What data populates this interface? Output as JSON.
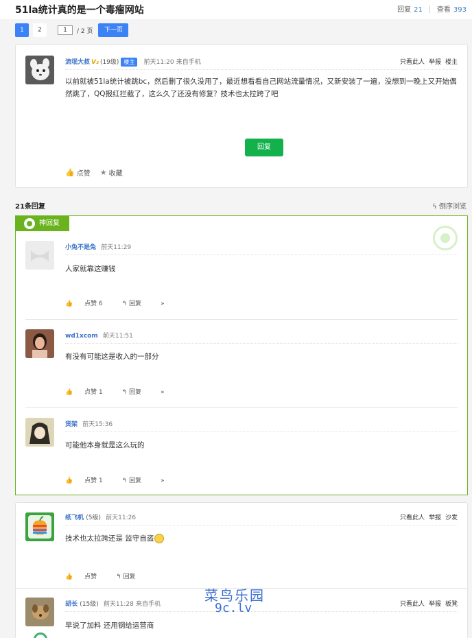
{
  "header": {
    "title": "51la统计真的是一个毒瘤网站",
    "reply_label": "回复",
    "reply_count": "21",
    "view_label": "查看",
    "view_count": "393"
  },
  "pager": {
    "page1": "1",
    "page2": "2",
    "input_value": "1",
    "total": "/ 2 页",
    "next": "下一页"
  },
  "main_post": {
    "username": "流氓大叔",
    "vip": "V₂",
    "level": "(19级)",
    "badge": "楼主",
    "time": "前天11:20",
    "source": "来自手机",
    "actions": [
      "只看此人",
      "举报",
      "楼主"
    ],
    "body_line1": "以前就被51la统计被跳bc，然后删了很久没用了，最近想看看自己网站流量情况，又新安装了一遍，没想到一晚上又开始偶",
    "body_line2": "然跳了，QQ报红拦截了，这么久了还没有修复？技术也太拉跨了吧",
    "reply_button": "回复",
    "like": "点赞",
    "favorite": "收藏"
  },
  "section": {
    "count_label": "21条回复",
    "sort_label": "ϟ 倒序浏览"
  },
  "god": {
    "tag": "神回复",
    "replies": [
      {
        "username": "小兔不是兔",
        "time": "前天11:29",
        "body": "人家就靠这赚钱",
        "like": "点赞 6",
        "reply": "回复",
        "more": "»"
      },
      {
        "username": "wd1xcom",
        "time": "前天11:51",
        "body": "有没有可能这是收入的一部分",
        "like": "点赞 1",
        "reply": "回复",
        "more": "»"
      },
      {
        "username": "货架",
        "time": "前天15:36",
        "body": "可能他本身就是这么玩的",
        "like": "点赞 1",
        "reply": "回复",
        "more": "»"
      }
    ]
  },
  "post2": {
    "username": "纸飞机",
    "level": "(5级)",
    "time": "前天11:26",
    "actions": [
      "只看此人",
      "举报",
      "沙发"
    ],
    "body": "技术也太拉跨还是 监守自盗",
    "like": "点赞",
    "reply": "回复"
  },
  "post3": {
    "username": "胡长",
    "level": "(15级)",
    "time": "前天11:28",
    "source": "来自手机",
    "actions": [
      "只看此人",
      "举报",
      "板凳"
    ],
    "body": "早说了加料 还用钢给运营商"
  },
  "watermark": {
    "line1": "菜鸟乐园",
    "line2": "9c.lv"
  }
}
